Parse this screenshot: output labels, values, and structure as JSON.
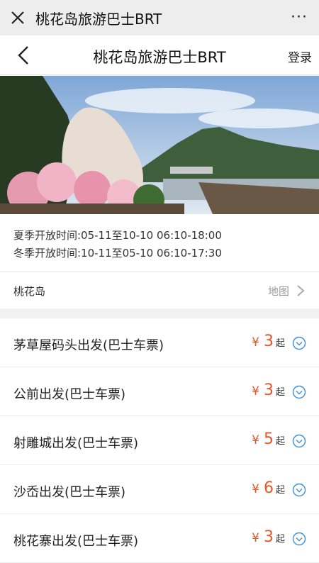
{
  "wechat": {
    "title": "桃花岛旅游巴士BRT",
    "close_icon": "close-icon",
    "more_icon": "more-icon",
    "more_text": "···"
  },
  "header": {
    "title": "桃花岛旅游巴士BRT",
    "login_label": "登录",
    "back_icon": "back-icon"
  },
  "banner": {
    "description": "scenic-photo"
  },
  "hours": {
    "summer": "夏季开放时间:05-11至10-10 06:10-18:00",
    "winter": "冬季开放时间:10-11至05-10 06:10-17:30"
  },
  "location": {
    "name": "桃花岛",
    "map_label": "地图"
  },
  "tickets": [
    {
      "name": "茅草屋码头出发(巴士车票)",
      "currency": "¥",
      "price": "3",
      "suffix": "起"
    },
    {
      "name": "公前出发(巴士车票)",
      "currency": "¥",
      "price": "3",
      "suffix": "起"
    },
    {
      "name": "射雕城出发(巴士车票)",
      "currency": "¥",
      "price": "5",
      "suffix": "起"
    },
    {
      "name": "沙岙出发(巴士车票)",
      "currency": "¥",
      "price": "6",
      "suffix": "起"
    },
    {
      "name": "桃花寨出发(巴士车票)",
      "currency": "¥",
      "price": "3",
      "suffix": "起"
    }
  ],
  "colors": {
    "price": "#e4572a",
    "accent": "#3a8fd9"
  }
}
